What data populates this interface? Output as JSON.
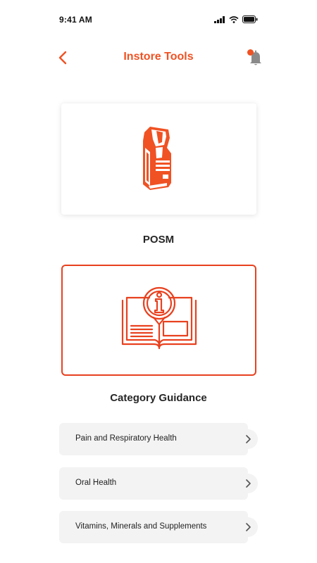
{
  "status_bar": {
    "time": "9:41 AM"
  },
  "header": {
    "title": "Instore Tools"
  },
  "cards": [
    {
      "label": "POSM",
      "icon": "posm-stand-icon"
    },
    {
      "label": "Category Guidance",
      "icon": "info-book-icon"
    }
  ],
  "categories": [
    {
      "label": "Pain and Respiratory Health"
    },
    {
      "label": "Oral Health"
    },
    {
      "label": "Vitamins, Minerals and Supplements"
    }
  ],
  "colors": {
    "accent": "#f05223",
    "card_border": "#e8411f",
    "list_bg": "#f3f3f3"
  }
}
